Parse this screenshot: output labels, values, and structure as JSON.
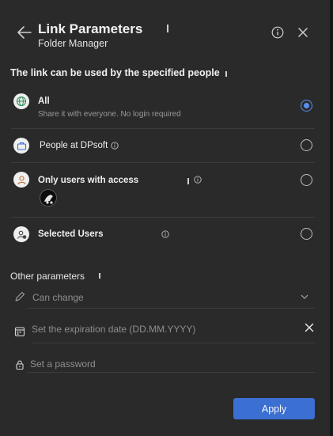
{
  "header": {
    "title": "Link Parameters",
    "subtitle": "Folder Manager"
  },
  "section_title": "The link can be used by the specified people",
  "options": [
    {
      "label": "All",
      "description": "Share it with everyone. No login required",
      "icon": "globe-icon",
      "selected": true
    },
    {
      "label": "People at DPsoft",
      "icon": "briefcase-icon",
      "selected": false
    },
    {
      "label": "Only users with access",
      "icon": "user-icon",
      "selected": false
    },
    {
      "label": "Selected Users",
      "icon": "user-group-icon",
      "selected": false
    }
  ],
  "other_parameters": {
    "title": "Other parameters",
    "permission": {
      "value": "Can change",
      "icon": "pencil-icon"
    },
    "expiration": {
      "placeholder": "Set the expiration date (DD.MM.YYYY)",
      "icon": "calendar-icon"
    },
    "password": {
      "placeholder": "Set a password",
      "icon": "lock-icon"
    }
  },
  "apply_label": "Apply",
  "colors": {
    "accent": "#3b6fd1",
    "radio_selected": "#5a8ef0",
    "panel_bg": "#2a2a2a"
  }
}
